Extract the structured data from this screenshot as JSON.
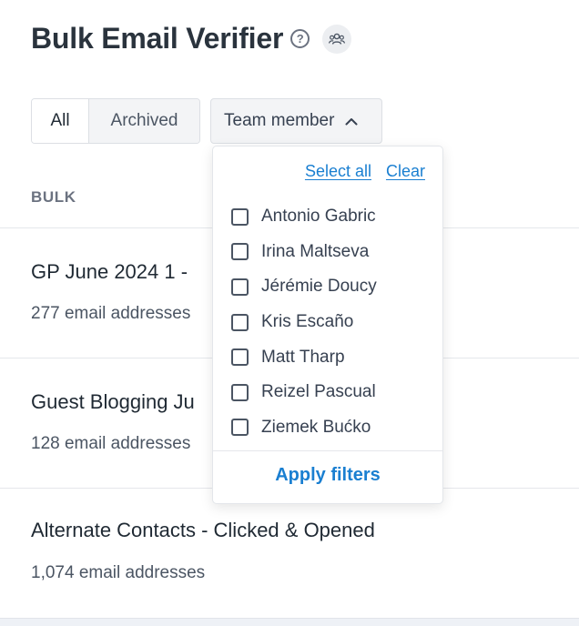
{
  "header": {
    "title": "Bulk Email Verifier",
    "help_icon": "question-circle-icon",
    "team_icon": "people-icon"
  },
  "filters": {
    "all_label": "All",
    "archived_label": "Archived",
    "team_member_label": "Team member"
  },
  "table": {
    "column_header": "BULK",
    "rows": [
      {
        "title": "GP June 2024 1 -",
        "subtitle": "277 email addresses"
      },
      {
        "title": "Guest Blogging Ju",
        "subtitle": "128 email addresses"
      },
      {
        "title": "Alternate Contacts - Clicked & Opened",
        "subtitle": "1,074 email addresses"
      }
    ]
  },
  "dropdown": {
    "select_all_label": "Select all",
    "clear_label": "Clear",
    "members": [
      "Antonio Gabric",
      "Irina Maltseva",
      "Jérémie Doucy",
      "Kris Escaño",
      "Matt Tharp",
      "Reizel Pascual",
      "Ziemek Bućko"
    ],
    "apply_label": "Apply filters"
  },
  "colors": {
    "accent": "#1a7fd1",
    "title": "#2a333d",
    "muted": "#6b7280"
  }
}
